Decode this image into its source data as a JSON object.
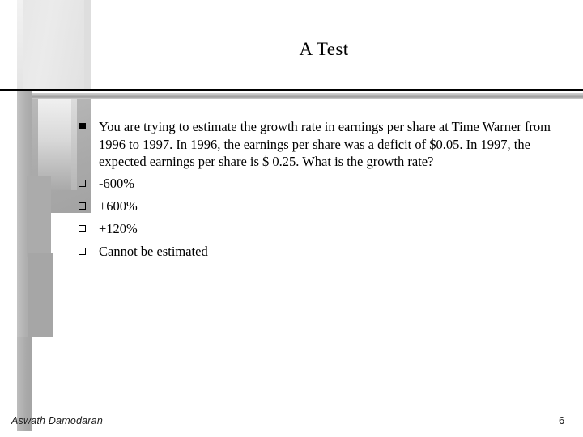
{
  "slide": {
    "title": "A Test",
    "background_color": "#ffffff",
    "rule_color": "#000000",
    "accent_gray": "#a9a9a9"
  },
  "content": {
    "bullets": [
      {
        "level": 1,
        "marker": "filled-square-bullet",
        "text": "You are trying to estimate the growth rate in earnings per share at Time Warner from 1996 to 1997. In 1996, the earnings per share was a deficit of $0.05. In 1997, the expected earnings per share is $ 0.25. What is the growth rate?"
      },
      {
        "level": 2,
        "marker": "hollow-square-bullet",
        "text": "-600%"
      },
      {
        "level": 2,
        "marker": "hollow-square-bullet",
        "text": "+600%"
      },
      {
        "level": 2,
        "marker": "hollow-square-bullet",
        "text": "+120%"
      },
      {
        "level": 2,
        "marker": "hollow-square-bullet",
        "text": "Cannot be estimated"
      }
    ]
  },
  "footer": {
    "author": "Aswath Damodaran",
    "page_number": "6"
  }
}
